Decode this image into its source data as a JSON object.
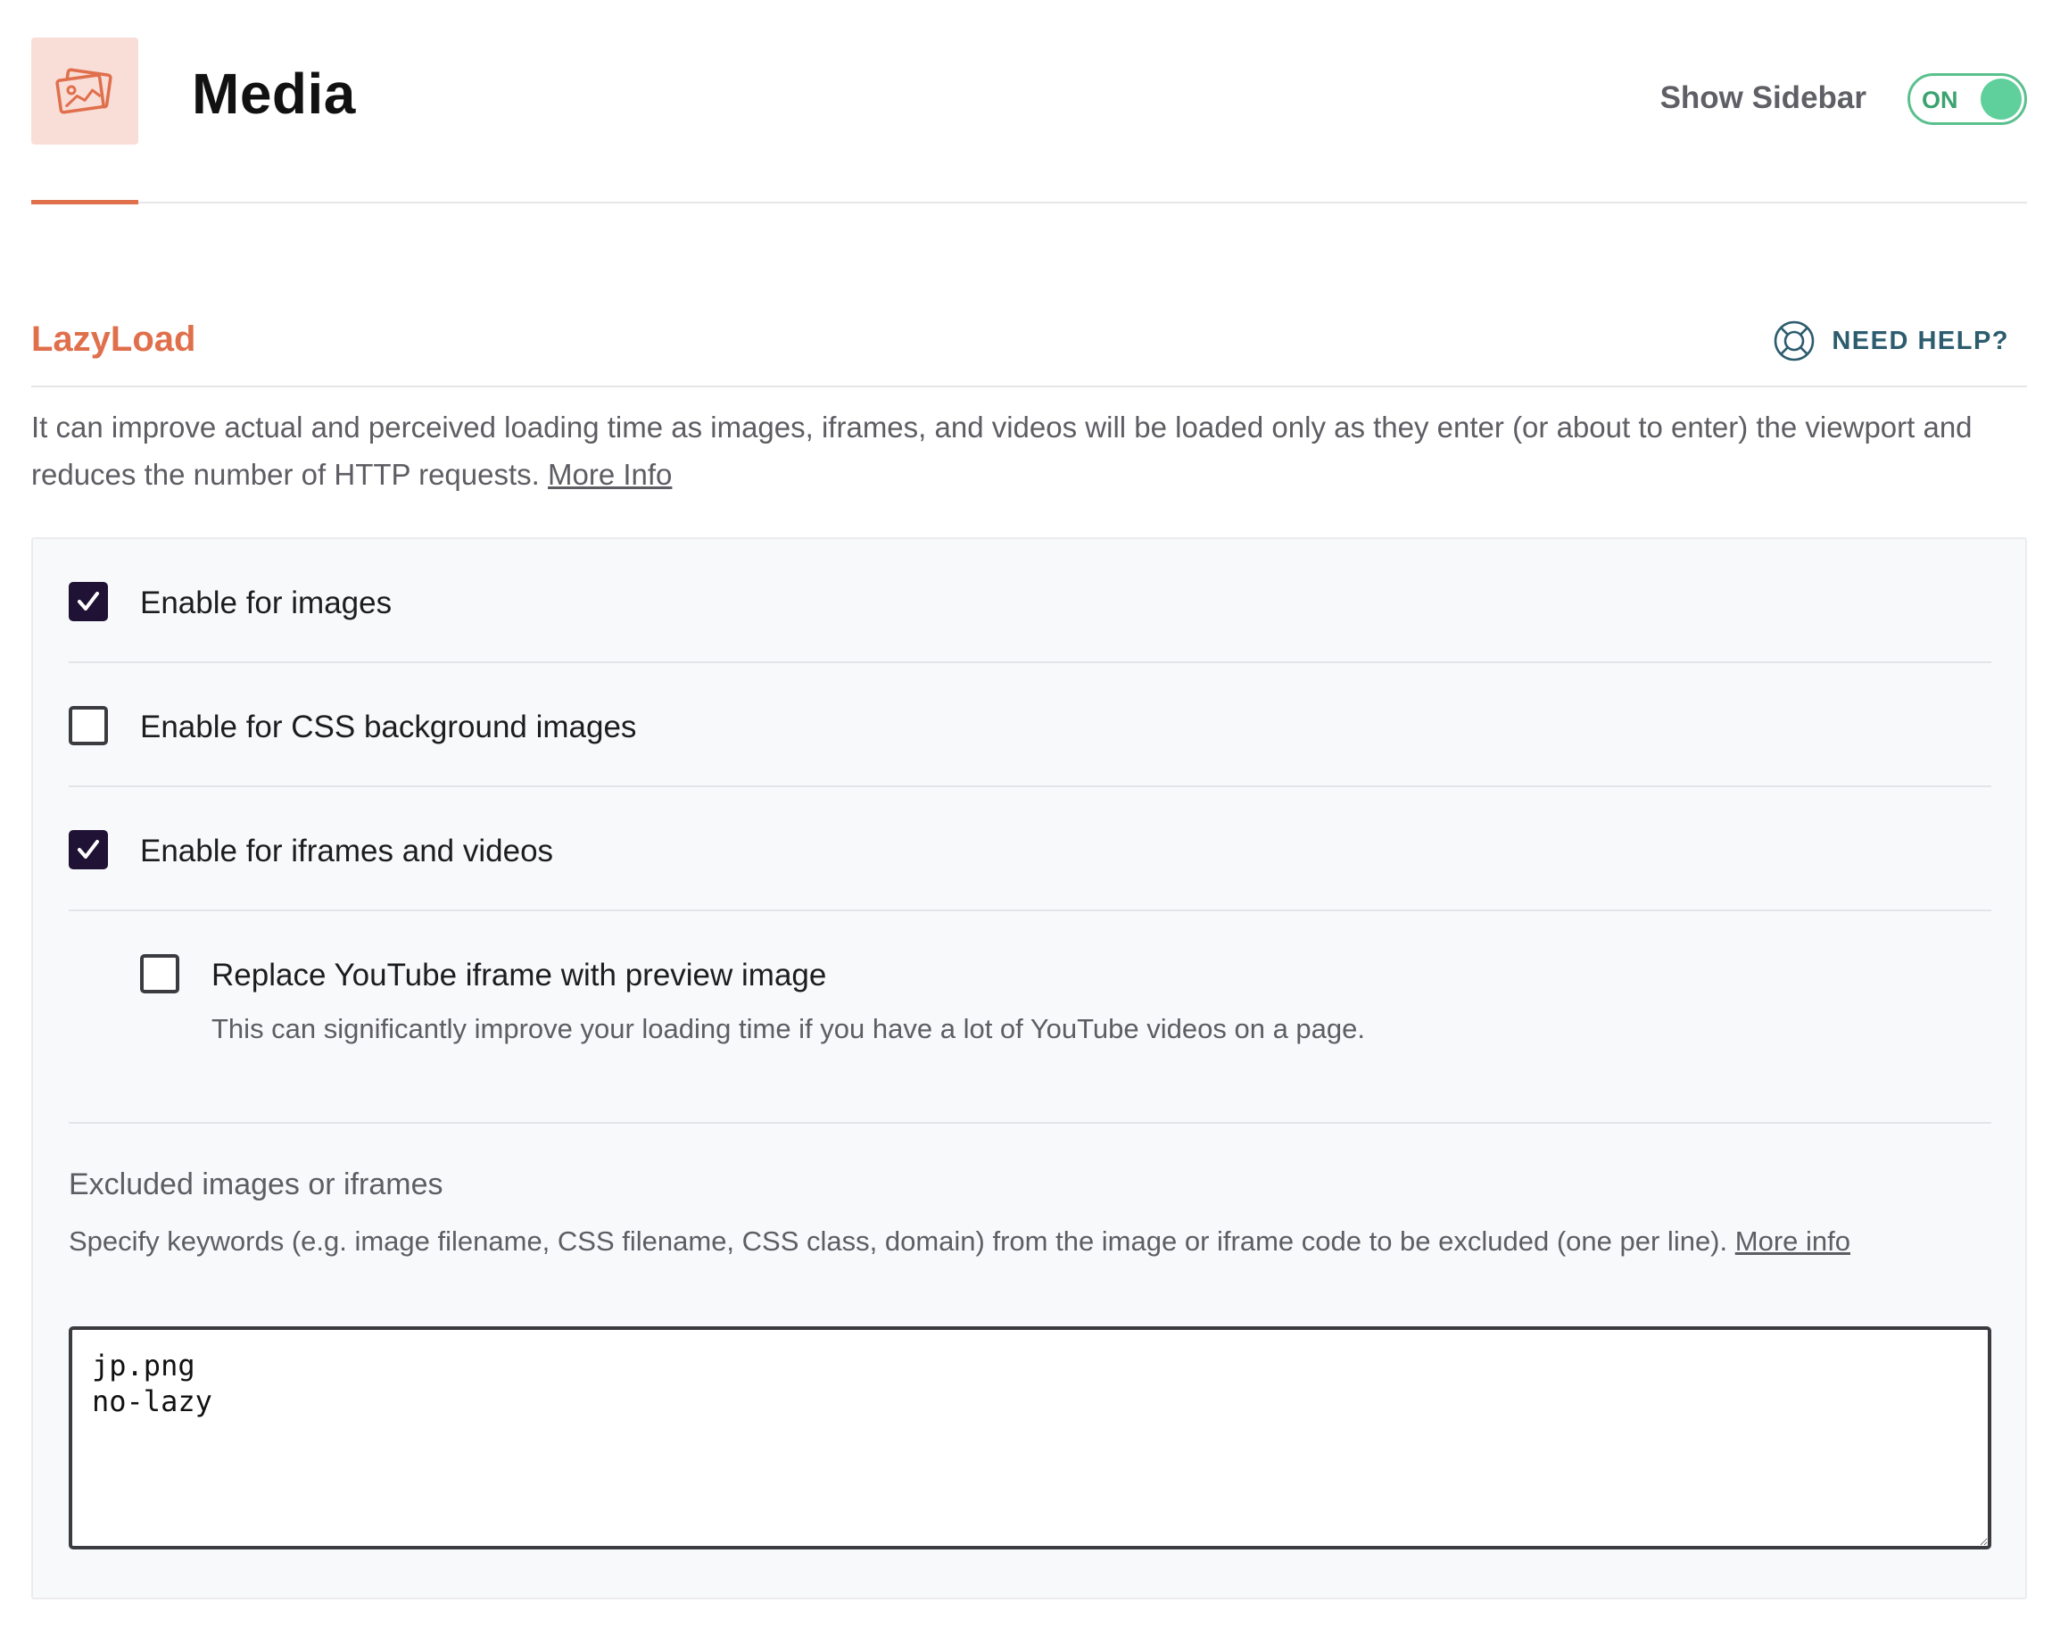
{
  "header": {
    "title": "Media",
    "tile_icon": "images-icon",
    "sidebar_toggle": {
      "label": "Show Sidebar",
      "state_text": "ON",
      "on": true
    }
  },
  "section": {
    "title": "LazyLoad",
    "help_label": "NEED HELP?",
    "help_icon": "lifebuoy-icon",
    "intro_text": "It can improve actual and perceived loading time as images, iframes, and videos will be loaded only as they enter (or about to enter) the viewport and reduces the number of HTTP requests.",
    "intro_link": "More Info"
  },
  "options": [
    {
      "label": "Enable for images",
      "checked": true
    },
    {
      "label": "Enable for CSS background images",
      "checked": false
    },
    {
      "label": "Enable for iframes and videos",
      "checked": true
    }
  ],
  "suboption": {
    "label": "Replace YouTube iframe with preview image",
    "description": "This can significantly improve your loading time if you have a lot of YouTube videos on a page.",
    "checked": false
  },
  "exclusions": {
    "title": "Excluded images or iframes",
    "description": "Specify keywords (e.g. image filename, CSS filename, CSS class, domain) from the image or iframe code to be excluded (one per line).",
    "link": "More info",
    "value": "jp.png\nno-lazy"
  },
  "colors": {
    "accent": "#e06f4c",
    "toggle_on": "#5fd09b",
    "checkbox_checked": "#1f1235",
    "help_link": "#2c5c6e"
  }
}
